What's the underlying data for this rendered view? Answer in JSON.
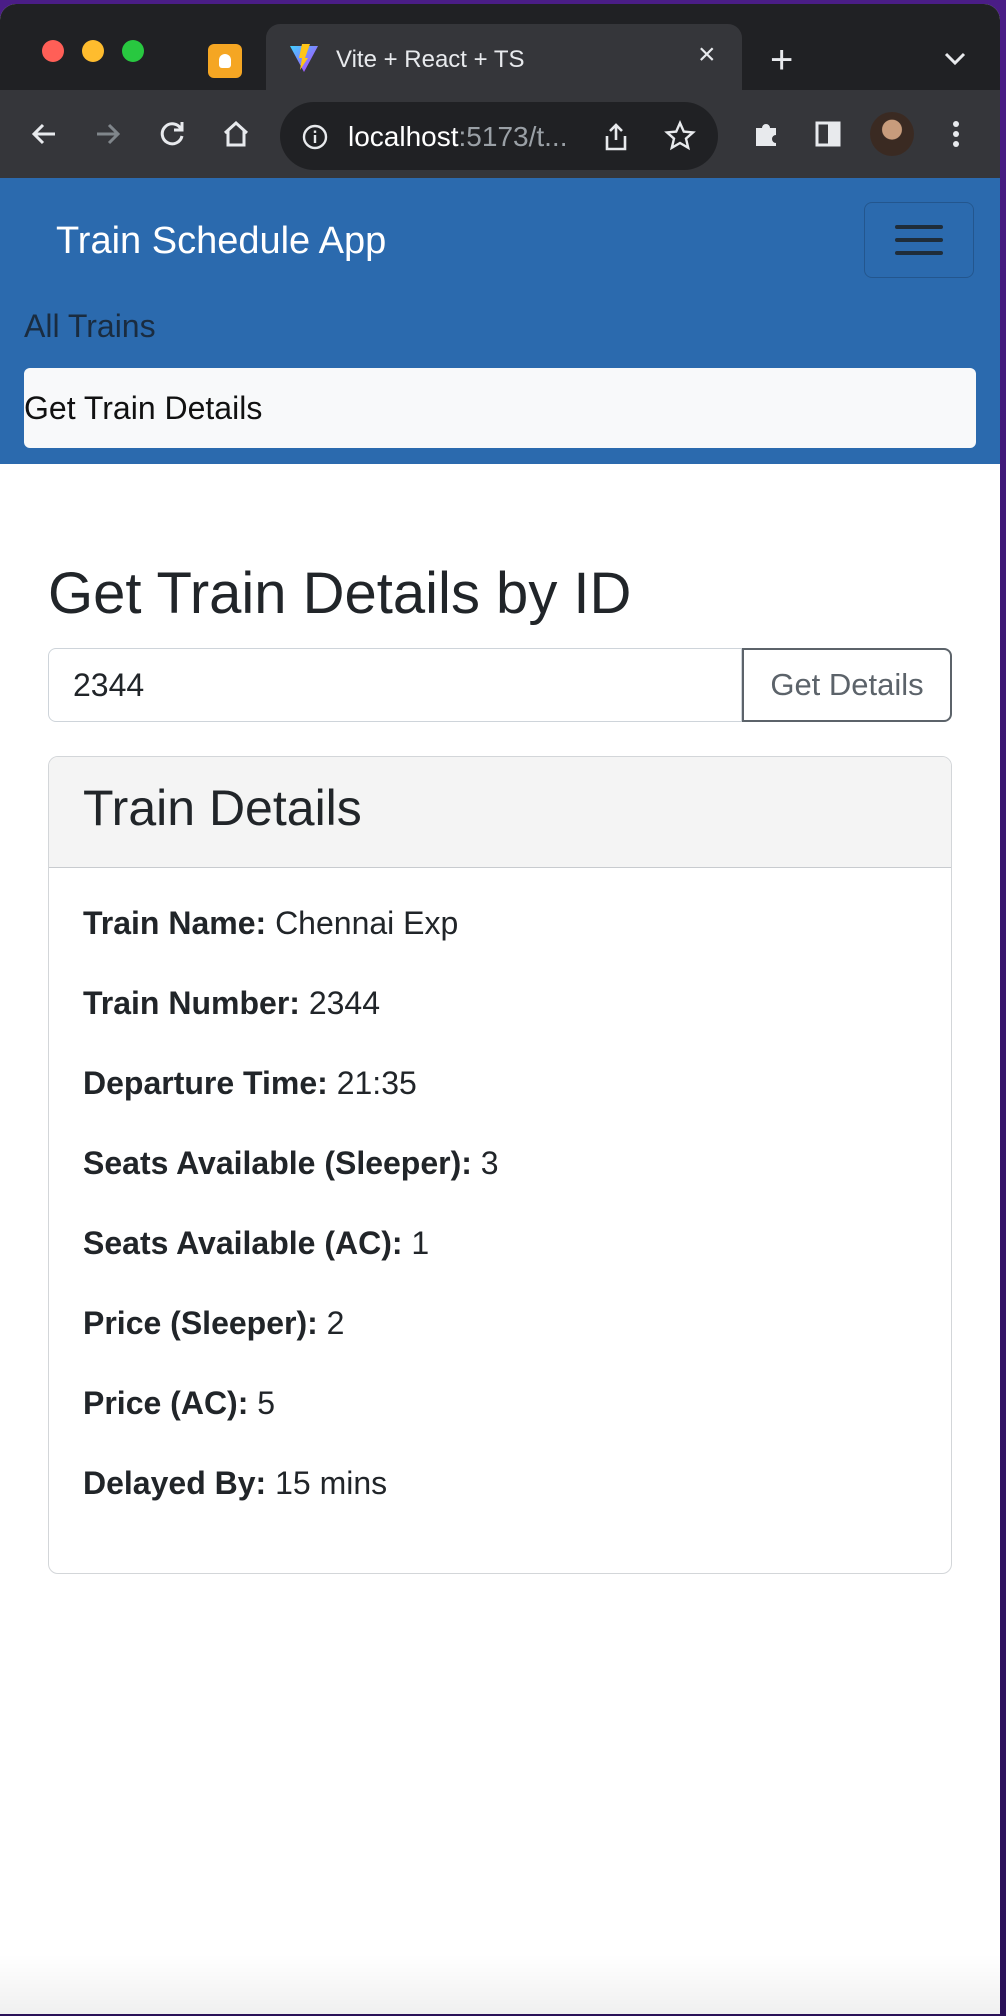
{
  "browser": {
    "tab_title": "Vite + React + TS",
    "tab_close": "×",
    "new_tab": "+",
    "url_host": "localhost",
    "url_rest": ":5173/t..."
  },
  "navbar": {
    "brand": "Train Schedule App",
    "links": [
      "All Trains",
      "Get Train Details"
    ]
  },
  "main": {
    "title": "Get Train Details by ID",
    "input_value": "2344",
    "button_label": "Get Details"
  },
  "card": {
    "title": "Train Details",
    "rows": [
      {
        "label": "Train Name:",
        "value": "Chennai Exp"
      },
      {
        "label": "Train Number:",
        "value": "2344"
      },
      {
        "label": "Departure Time:",
        "value": "21:35"
      },
      {
        "label": "Seats Available (Sleeper):",
        "value": "3"
      },
      {
        "label": "Seats Available (AC):",
        "value": "1"
      },
      {
        "label": "Price (Sleeper):",
        "value": "2"
      },
      {
        "label": "Price (AC):",
        "value": "5"
      },
      {
        "label": "Delayed By:",
        "value": "15 mins"
      }
    ]
  },
  "colors": {
    "navbar_bg": "#2b6aae",
    "browser_dark": "#202124",
    "toolbar": "#35363a"
  }
}
